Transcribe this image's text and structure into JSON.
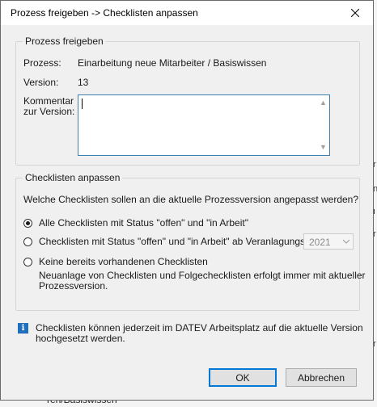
{
  "window": {
    "title": "Prozess freigeben -> Checklisten anpassen",
    "close_icon": "close-icon"
  },
  "release_group": {
    "legend": "Prozess freigeben",
    "process_label": "Prozess:",
    "process_value": "Einarbeitung neue Mitarbeiter / Basiswissen",
    "version_label": "Version:",
    "version_value": "13",
    "comment_label_line1": "Kommentar",
    "comment_label_line2": "zur Version:",
    "comment_value": ""
  },
  "checklist_group": {
    "legend": "Checklisten anpassen",
    "question": "Welche Checklisten sollen an die aktuelle Prozessversion angepasst werden?",
    "options": [
      {
        "label": "Alle Checklisten mit Status \"offen\" und \"in Arbeit\"",
        "checked": true
      },
      {
        "label": "Checklisten mit Status \"offen\" und \"in Arbeit\" ab Veranlagungsjahr:",
        "checked": false
      },
      {
        "label": "Keine bereits vorhandenen Checklisten",
        "checked": false
      }
    ],
    "year_value": "2021",
    "option3_note_line1": "Neuanlage von Checklisten und Folgechecklisten erfolgt immer mit aktueller",
    "option3_note_line2": "Prozessversion."
  },
  "info": {
    "icon": "info-icon",
    "line1": "Checklisten können jederzeit im DATEV Arbeitsplatz auf die aktuelle Version",
    "line2": "hochgesetzt werden."
  },
  "buttons": {
    "ok": "OK",
    "cancel": "Abbrechen"
  },
  "background": {
    "partial_text": "ren/Basiswissen"
  }
}
